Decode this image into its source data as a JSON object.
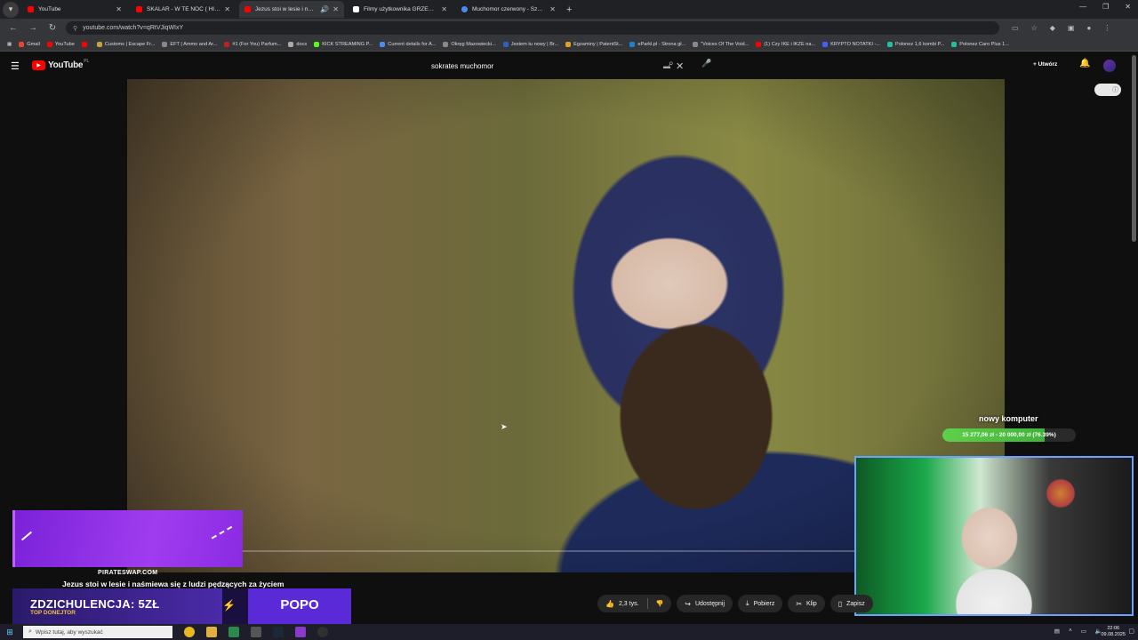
{
  "browser": {
    "tabs": [
      {
        "title": "YouTube",
        "favicon_color": "#ff0000"
      },
      {
        "title": "SKALAR - W TE NOC ( HIT Dis",
        "favicon_color": "#ff0000"
      },
      {
        "title": "Jezus stoi w lesie i naśmiew",
        "favicon_color": "#ff0000",
        "active": true
      },
      {
        "title": "Filmy użytkownika GRZESIU.P",
        "favicon_color": "#ffffff"
      },
      {
        "title": "Muchomor czerwony - Szukaj",
        "favicon_color": "#4a8af4"
      }
    ],
    "new_tab": "+",
    "url": "youtube.com/watch?v=qRtVJiqWIxY",
    "bookmarks": [
      {
        "label": "Gmail",
        "color": "#ea4335"
      },
      {
        "label": "YouTube",
        "color": "#ff0000"
      },
      {
        "label": "",
        "color": "#ff0000"
      },
      {
        "label": "Customs | Escape Fr...",
        "color": "#c8a040"
      },
      {
        "label": "EFT | Ammo and Ar...",
        "color": "#888888"
      },
      {
        "label": "#1 (For You) Parfum...",
        "color": "#c02020"
      },
      {
        "label": "docs",
        "color": "#aaaaaa"
      },
      {
        "label": "KICK STREAMING P...",
        "color": "#53fc18"
      },
      {
        "label": "Current details for A...",
        "color": "#4a8af4"
      },
      {
        "label": "Okręg Mazowiecki...",
        "color": "#888888"
      },
      {
        "label": "Jestem tu nowy | Br...",
        "color": "#3060c0"
      },
      {
        "label": "Egzaminy | PatentSt...",
        "color": "#e0a020"
      },
      {
        "label": "eParkl.pl - Strona gł...",
        "color": "#2080d0"
      },
      {
        "label": "\"Voices Of The Void...",
        "color": "#888888"
      },
      {
        "label": "(1) Czy IKE i IKZE na...",
        "color": "#ff0000"
      },
      {
        "label": "KRYPTO NOTATKI -...",
        "color": "#4060ff"
      },
      {
        "label": "Polonez 1,6 kombi P...",
        "color": "#20c0a0"
      },
      {
        "label": "Polonez Caro Plus 1...",
        "color": "#20c0a0"
      }
    ]
  },
  "youtube": {
    "logo": "YouTube",
    "country": "PL",
    "search_value": "sokrates muchomor",
    "create_label": "Utwórz",
    "actions": {
      "likes": "2,3 tys.",
      "share": "Udostępnij",
      "download": "Pobierz",
      "clip": "Klip",
      "save": "Zapisz"
    }
  },
  "overlay": {
    "goal_title": "nowy komputer",
    "goal_text": "15 277,06 zł - 20 000,00 zł (76.39%)",
    "goal_progress": 0.7639,
    "site_label": "PIRATESWAP.COM",
    "video_title": "Jezus stoi w lesie i naśmiewa się z ludzi pędzących za życiem",
    "donation_promo": "ZDZICHULENCJA: 5ZŁ",
    "donation_sub": "TOP DONEJTOR",
    "donor_name": "POPO"
  },
  "taskbar": {
    "search_placeholder": "Wpisz tutaj, aby wyszukać",
    "time": "22:06",
    "date": "09.08.2025"
  },
  "colors": {
    "accent_red": "#ff0000",
    "goal_green": "#4fc443",
    "donation_purple": "#8a2be2",
    "webcam_border": "#6ea0ff"
  }
}
